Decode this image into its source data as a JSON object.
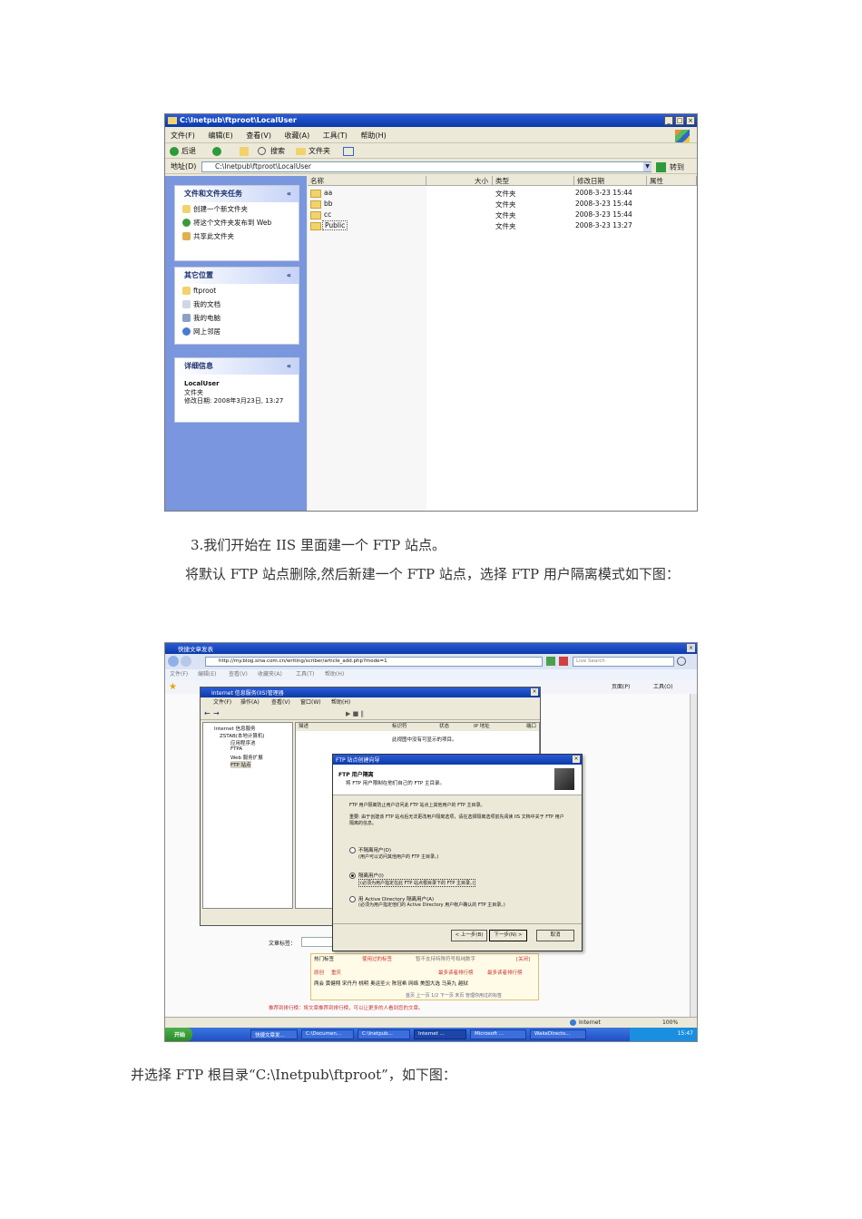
{
  "explorer": {
    "title": "C:\\Inetpub\\ftproot\\LocalUser",
    "menu": [
      "文件(F)",
      "编辑(E)",
      "查看(V)",
      "收藏(A)",
      "工具(T)",
      "帮助(H)"
    ],
    "toolbar": {
      "back": "后退",
      "search": "搜索",
      "folders": "文件夹"
    },
    "address_label": "地址(D)",
    "address_value": "C:\\Inetpub\\ftproot\\LocalUser",
    "go_label": "转到",
    "tasks": {
      "title": "文件和文件夹任务",
      "items": [
        "创建一个新文件夹",
        "将这个文件夹发布到 Web",
        "共享此文件夹"
      ]
    },
    "other": {
      "title": "其它位置",
      "items": [
        "ftproot",
        "我的文档",
        "我的电脑",
        "网上邻居"
      ]
    },
    "details": {
      "title": "详细信息",
      "name": "LocalUser",
      "type": "文件夹",
      "modified": "修改日期: 2008年3月23日, 13:27"
    },
    "columns": [
      "名称",
      "大小",
      "类型",
      "修改日期",
      "属性"
    ],
    "rows": [
      {
        "name": "aa",
        "type": "文件夹",
        "date": "2008-3-23 15:44"
      },
      {
        "name": "bb",
        "type": "文件夹",
        "date": "2008-3-23 15:44"
      },
      {
        "name": "cc",
        "type": "文件夹",
        "date": "2008-3-23 15:44"
      },
      {
        "name": "Public",
        "type": "文件夹",
        "date": "2008-3-23 13:27"
      }
    ]
  },
  "text": {
    "step3": "3.我们开始在 IIS 里面建一个 FTP 站点。",
    "step3_detail": "将默认 FTP 站点删除,然后新建一个 FTP 站点，选择 FTP 用户隔离模式如下图：",
    "root_dir": "并选择 FTP 根目录“C:\\Inetpub\\ftproot”，如下图："
  },
  "ie": {
    "tab_title": "快捷文章发表",
    "address": "http://my.blog.sina.com.cn/writing/scriber/article_add.php?mode=1",
    "search_placeholder": "Live Search",
    "menu": [
      "文件(F)",
      "编辑(E)",
      "查看(V)",
      "收藏夹(A)",
      "工具(T)",
      "帮助(H)"
    ],
    "page_tool": "页面(P)",
    "tools_tool": "工具(O)",
    "status": "Internet",
    "zoom": "100%",
    "article_label": "文章标签：",
    "tag_tabs": [
      "热门标签",
      "使用过的标签"
    ],
    "tag_note": "暂不支持特殊符号和纯数字",
    "tag_close": "[关闭]",
    "tags_row1": [
      "原创",
      "重庆"
    ],
    "tags_row2": [
      "两会",
      "黄健翔",
      "宋丹丹",
      "桃明",
      "奥运圣火",
      "陈冠希",
      "网络",
      "美国大选",
      "马英九",
      "越狱"
    ],
    "rank_links": [
      "最多读者排行榜",
      "最多读者排行榜"
    ],
    "pager": "首页 上一页 1/2 下一页 末页 管理你用过的标签",
    "recommend": "推荐到排行榜：将文章推荐到排行榜，可以让更多的人看到您的文章。"
  },
  "iis": {
    "title": "Internet 信息服务(IIS)管理器",
    "menu": [
      "文件(F)",
      "操作(A)",
      "查看(V)",
      "窗口(W)",
      "帮助(H)"
    ],
    "tree": [
      "Internet 信息服务",
      "ZSTAB(本地计算机)",
      "应用程序池",
      "FTPA",
      "Web 服务扩展",
      "FTP 站点"
    ],
    "columns": [
      "描述",
      "标识符",
      "状态",
      "IP 地址",
      "端口"
    ],
    "empty": "此视图中没有可显示的项目。"
  },
  "wizard": {
    "title": "FTP 站点创建向导",
    "section_title": "FTP 用户隔离",
    "section_sub": "将 FTP 用户限制在他们自己的 FTP 主目录。",
    "desc1": "FTP 用户隔离防止用户访问此 FTP 站点上其他用户的 FTP 主目录。",
    "desc2": "重要: 由于创建该 FTP 站点后无法更改用户隔离选项，请在选择隔离选项前先阅读 IIS 文档中关于 FTP 用户隔离的信息。",
    "options": [
      {
        "label": "不隔离用户(D)",
        "sub": "(用户可以访问其他用户的 FTP 主目录。)",
        "selected": false
      },
      {
        "label": "隔离用户(I)",
        "sub": "(必须为用户指定在此 FTP 站点根目录下的 FTP 主目录。)",
        "selected": true
      },
      {
        "label": "用 Active Directory 隔离用户(A)",
        "sub": "(必须为用户指定他们的 Active Directory 用户帐户确认的 FTP 主目录。)",
        "selected": false
      }
    ],
    "back": "< 上一步(B)",
    "next": "下一步(N) >",
    "cancel": "取消"
  },
  "taskbar": {
    "start": "开始",
    "items": [
      "快捷文章发...",
      "C:\\Documen...",
      "C:\\Inetpub...",
      "Internet ...",
      "Microsoft ...",
      "WakeDirects..."
    ],
    "clock": "15:47"
  }
}
